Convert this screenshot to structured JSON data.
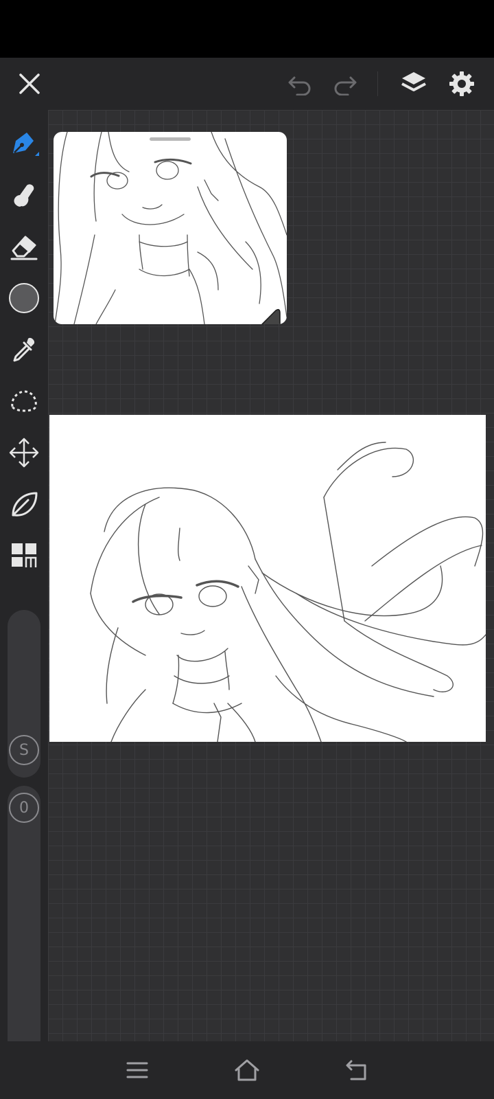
{
  "app": {
    "toolbar": {
      "close": "close",
      "undo": "undo",
      "redo": "redo",
      "layers": "layers",
      "settings": "settings"
    },
    "tools": [
      {
        "name": "pen",
        "active": true
      },
      {
        "name": "smudge"
      },
      {
        "name": "eraser"
      },
      {
        "name": "color",
        "value": "#5a5a5c"
      },
      {
        "name": "eyedropper"
      },
      {
        "name": "lasso"
      },
      {
        "name": "move"
      },
      {
        "name": "leaf"
      },
      {
        "name": "panels"
      }
    ],
    "size_slider_label": "S",
    "opacity_slider_label": "0",
    "accent": "#2a86e6"
  }
}
